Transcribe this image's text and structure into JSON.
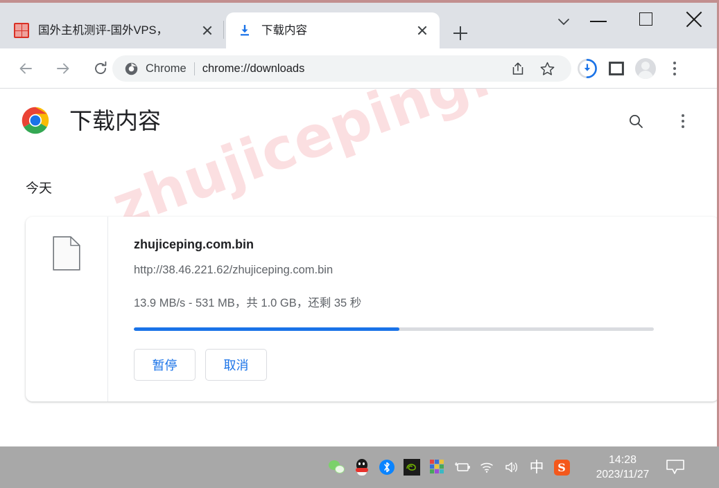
{
  "window": {
    "controls": {
      "minimize": "minimize",
      "maximize": "maximize",
      "close": "close"
    },
    "tab_search": "tab-search"
  },
  "tabs": [
    {
      "title": "国外主机测评-国外VPS，",
      "favicon": "red-seal-favicon",
      "active": false,
      "close_label": "close-tab"
    },
    {
      "title": "下载内容",
      "favicon": "download-icon",
      "active": true,
      "close_label": "close-tab"
    }
  ],
  "new_tab_label": "new-tab",
  "toolbar": {
    "back": "back-arrow-icon",
    "forward": "forward-arrow-icon",
    "reload": "reload-icon",
    "omnibox": {
      "chrome_label": "Chrome",
      "url": "chrome://downloads",
      "chrome_icon": "chrome-icon"
    },
    "share": "share-icon",
    "bookmark": "star-icon",
    "download_progress": "download-progress-icon",
    "side_panel": "side-panel-icon",
    "profile": "avatar-icon",
    "menu": "three-dot-menu-icon"
  },
  "page": {
    "logo": "chrome-logo",
    "title": "下载内容",
    "search_label": "search-icon",
    "menu_label": "three-dot-menu-icon",
    "group_label": "今天",
    "watermark": "zhujiceping.com",
    "download": {
      "file_icon": "generic-file-icon",
      "name": "zhujiceping.com.bin",
      "url": "http://38.46.221.62/zhujiceping.com.bin",
      "status": "13.9 MB/s - 531 MB，共 1.0 GB，还剩 35 秒",
      "progress_percent": 51,
      "buttons": {
        "pause": "暂停",
        "cancel": "取消"
      }
    }
  },
  "taskbar": {
    "tray": [
      "wechat-icon",
      "qq-icon",
      "bluetooth-icon",
      "nvidia-icon",
      "app-grid-icon",
      "battery-icon",
      "wifi-icon",
      "volume-icon",
      "ime-chinese-icon",
      "sogou-icon"
    ],
    "ime_glyph": "中",
    "sogou_glyph": "S",
    "clock": {
      "time": "14:28",
      "date": "2023/11/27"
    },
    "notification": "notification-icon"
  },
  "colors": {
    "accent_blue": "#1a73e8",
    "tabstrip": "#dee1e6",
    "watermark_pink": "#fbdfe1",
    "taskbar_gray": "#a8a8a8",
    "window_border": "#c28f8f"
  }
}
